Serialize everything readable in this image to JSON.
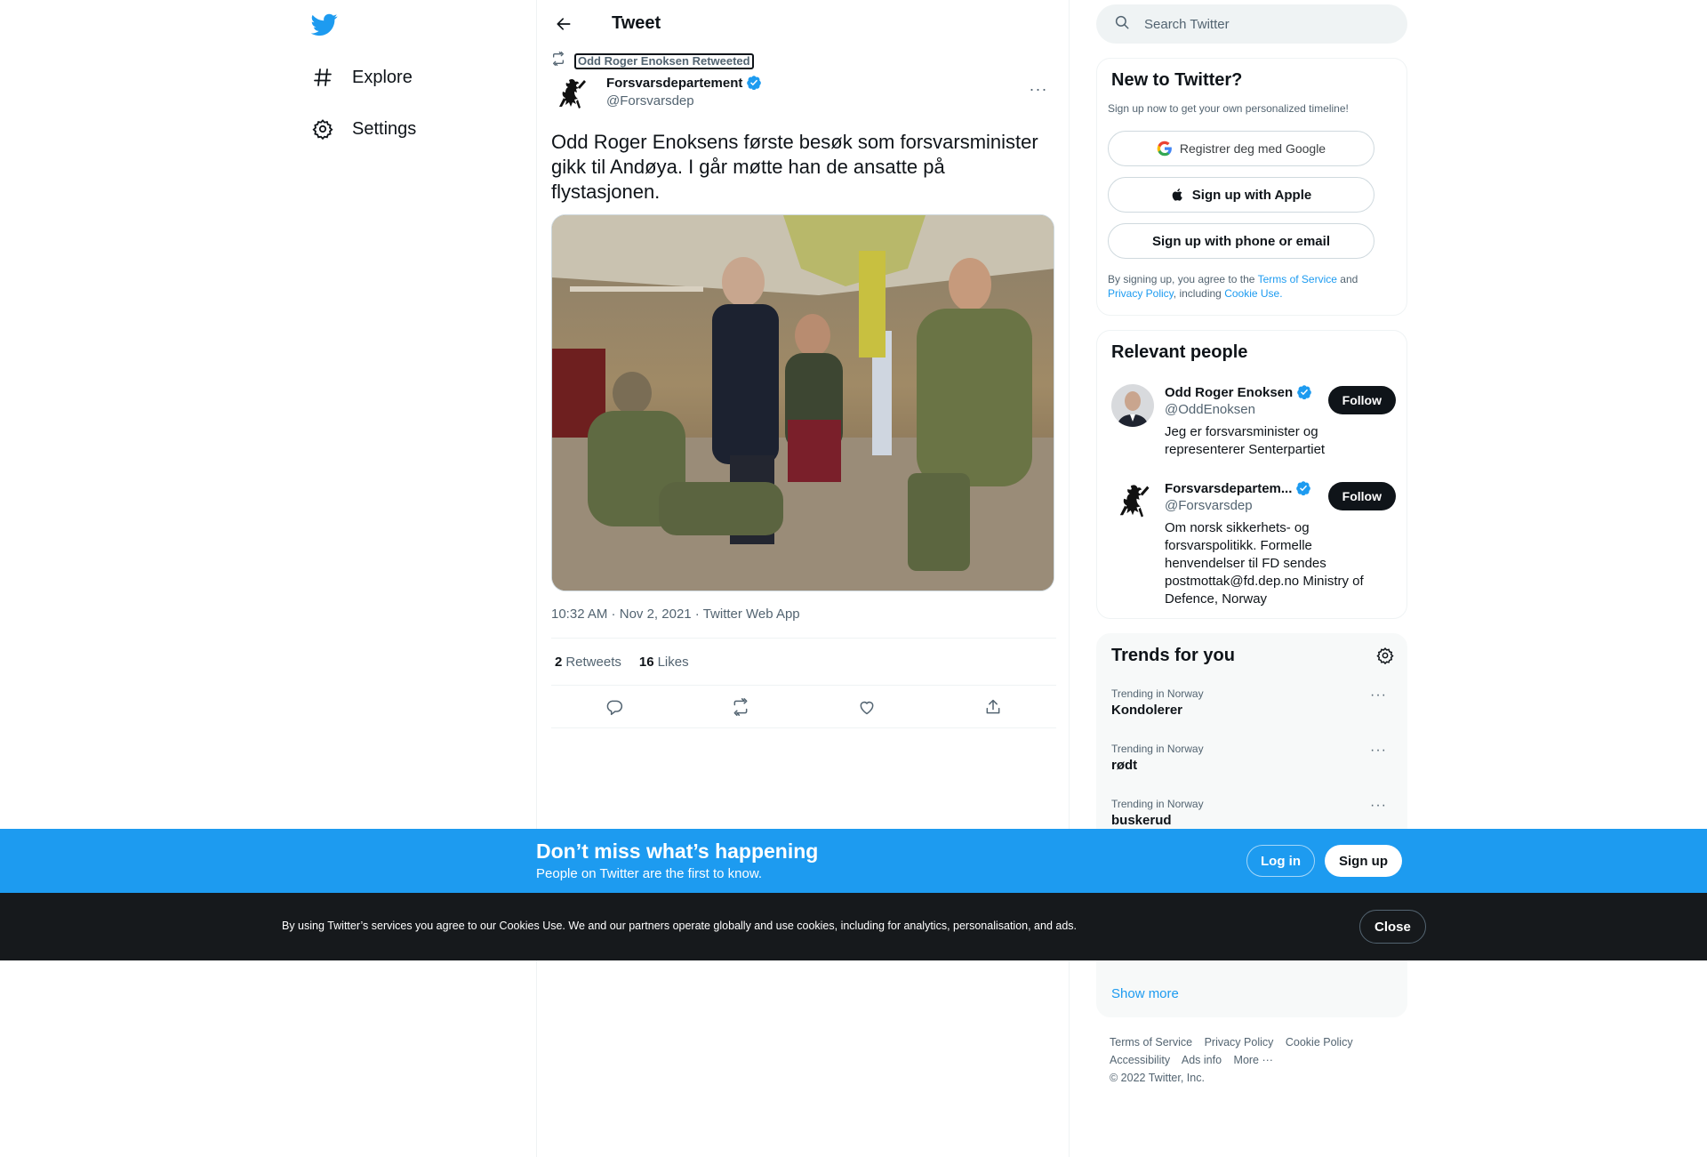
{
  "nav": {
    "items": [
      {
        "label": "Explore",
        "icon": "hashtag-icon"
      },
      {
        "label": "Settings",
        "icon": "gear-icon"
      }
    ]
  },
  "header": {
    "title": "Tweet"
  },
  "tweet": {
    "retweeted_by": "Odd Roger Enoksen Retweeted",
    "author_name": "Forsvarsdepartement",
    "author_handle": "@Forsvarsdep",
    "text": "Odd Roger Enoksens første besøk som forsvarsminister gikk til Andøya. I går møtte han de ansatte på flystasjonen.",
    "time": "10:32 AM",
    "date": "Nov 2, 2021",
    "source": "Twitter Web App",
    "retweets_count": "2",
    "retweets_label": "Retweets",
    "likes_count": "16",
    "likes_label": "Likes"
  },
  "search": {
    "placeholder": "Search Twitter"
  },
  "new_to_twitter": {
    "title": "New to Twitter?",
    "subtitle": "Sign up now to get your own personalized timeline!",
    "google_label": "Registrer deg med Google",
    "apple_label": "Sign up with Apple",
    "phone_label": "Sign up with phone or email",
    "legal_prefix": "By signing up, you agree to the",
    "terms_link": "Terms of Service",
    "legal_and": "and",
    "privacy_link": "Privacy Policy",
    "legal_including": ", including",
    "cookie_link": "Cookie Use."
  },
  "relevant_people": {
    "title": "Relevant people",
    "people": [
      {
        "name": "Odd Roger Enoksen",
        "handle": "@OddEnoksen",
        "bio": "Jeg er forsvarsminister og representerer Senterpartiet",
        "button": "Follow"
      },
      {
        "name": "Forsvarsdepartem...",
        "handle": "@Forsvarsdep",
        "bio": "Om norsk sikkerhets- og forsvarspolitikk. Formelle henvendelser til FD sendes postmottak@fd.dep.no Ministry of Defence, Norway",
        "button": "Follow"
      }
    ]
  },
  "trends": {
    "title": "Trends for you",
    "items": [
      {
        "meta": "Trending in Norway",
        "name": "Kondolerer"
      },
      {
        "meta": "Trending in Norway",
        "name": "rødt"
      },
      {
        "meta": "Trending in Norway",
        "name": "buskerud"
      }
    ],
    "show_more": "Show more"
  },
  "footer": {
    "links": [
      "Terms of Service",
      "Privacy Policy",
      "Cookie Policy",
      "Accessibility",
      "Ads info",
      "More ···"
    ],
    "copyright": "© 2022 Twitter, Inc."
  },
  "signup_bar": {
    "title": "Don’t miss what’s happening",
    "subtitle": "People on Twitter are the first to know.",
    "login": "Log in",
    "signup": "Sign up"
  },
  "cookie_bar": {
    "text": "By using Twitter’s services you agree to our Cookies Use. We and our partners operate globally and use cookies, including for analytics, personalisation, and ads.",
    "close": "Close"
  },
  "colors": {
    "accent": "#1d9bf0",
    "text": "#0f1419",
    "secondary": "#536471",
    "cookie_bg": "#16191c"
  }
}
